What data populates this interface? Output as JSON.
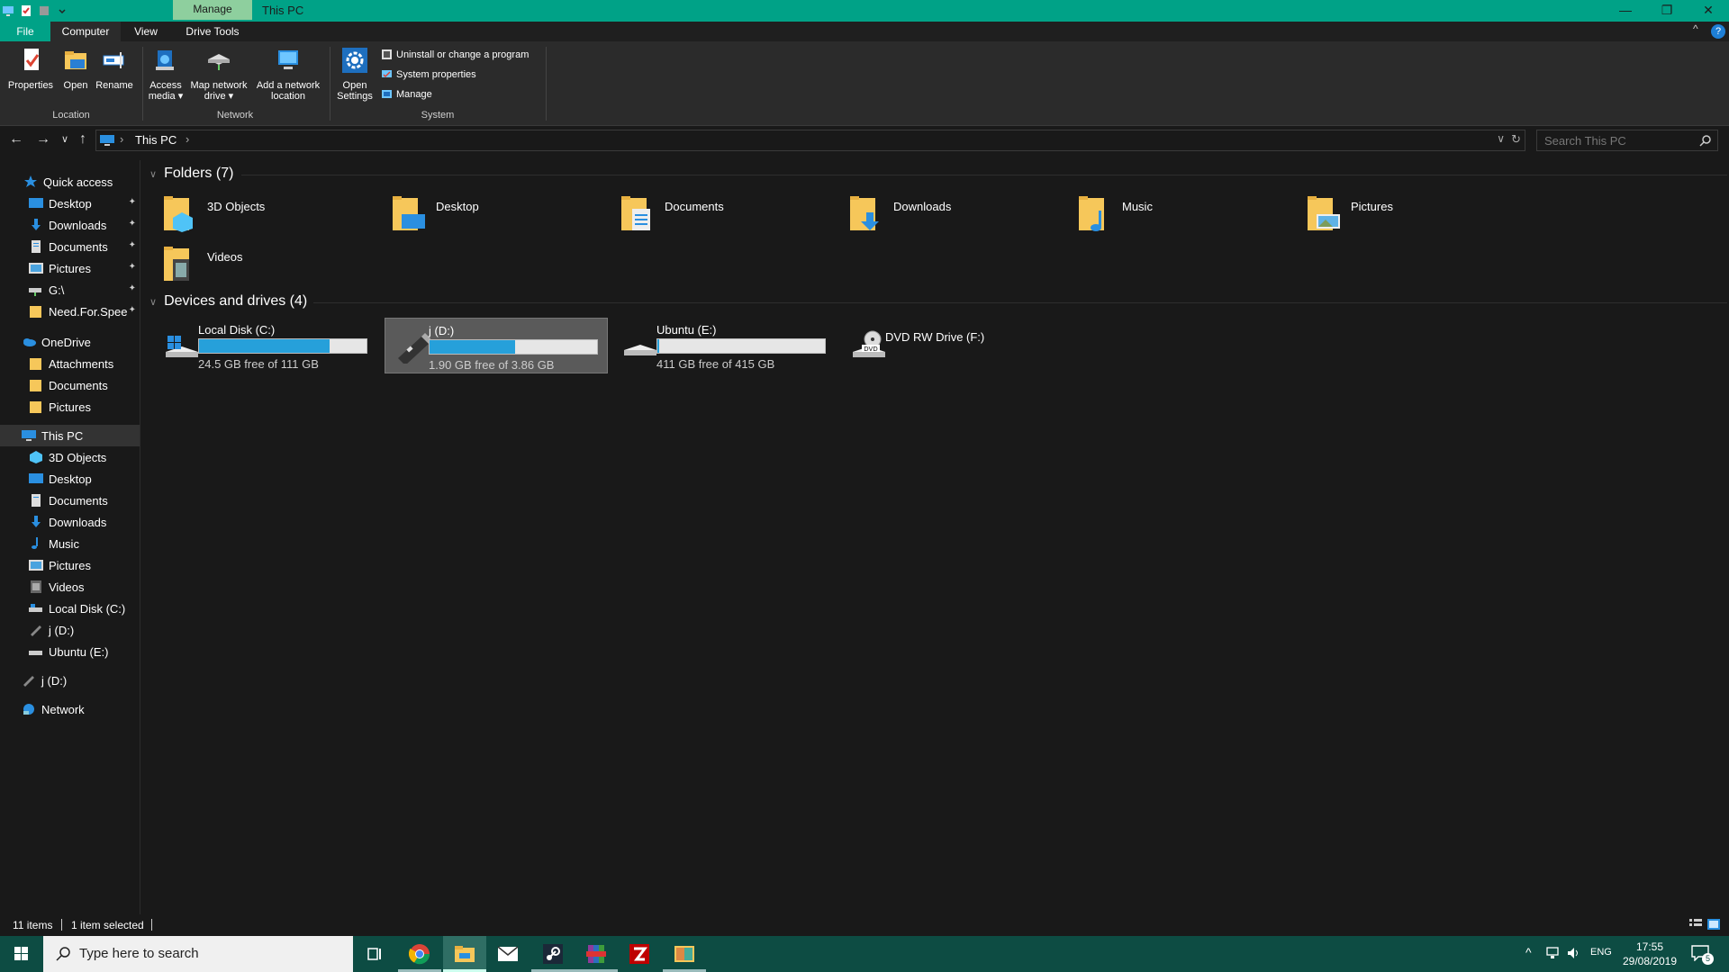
{
  "window": {
    "title": "This PC",
    "context_tab": "Manage",
    "minimize": "—",
    "restore": "❐",
    "close": "✕"
  },
  "ribbon": {
    "tabs": {
      "file": "File",
      "computer": "Computer",
      "view": "View",
      "drive_tools": "Drive Tools"
    },
    "location": {
      "label": "Location",
      "properties": "Properties",
      "open": "Open",
      "rename": "Rename"
    },
    "network": {
      "label": "Network",
      "access_media_1": "Access",
      "access_media_2": "media ▾",
      "map_drive_1": "Map network",
      "map_drive_2": "drive ▾",
      "add_location_1": "Add a network",
      "add_location_2": "location"
    },
    "system": {
      "label": "System",
      "open_settings_1": "Open",
      "open_settings_2": "Settings",
      "uninstall": "Uninstall or change a program",
      "system_properties": "System properties",
      "manage": "Manage"
    },
    "collapse": "^",
    "help": "?"
  },
  "address": {
    "crumb": "This PC",
    "sep": "›",
    "dropdown": "∨",
    "refresh": "↻",
    "search_placeholder": "Search This PC"
  },
  "nav": {
    "back": "←",
    "forward": "→",
    "recent": "∨",
    "up": "↑"
  },
  "sidebar": {
    "quick_access": "Quick access",
    "qa_items": [
      "Desktop",
      "Downloads",
      "Documents",
      "Pictures",
      "G:\\",
      "Need.For.Spee"
    ],
    "onedrive": "OneDrive",
    "od_items": [
      "Attachments",
      "Documents",
      "Pictures"
    ],
    "this_pc": "This PC",
    "pc_items": [
      "3D Objects",
      "Desktop",
      "Documents",
      "Downloads",
      "Music",
      "Pictures",
      "Videos",
      "Local Disk (C:)",
      "j (D:)",
      "Ubuntu (E:)"
    ],
    "removable": "j (D:)",
    "network": "Network",
    "pin": "📌"
  },
  "content": {
    "folders_header": "Folders (7)",
    "folders": [
      "3D Objects",
      "Desktop",
      "Documents",
      "Downloads",
      "Music",
      "Pictures",
      "Videos"
    ],
    "devices_header": "Devices and drives (4)",
    "drives": [
      {
        "name": "Local Disk (C:)",
        "free": "24.5 GB free of 111 GB",
        "used_fraction": 0.78
      },
      {
        "name": "j (D:)",
        "free": "1.90 GB free of 3.86 GB",
        "used_fraction": 0.51
      },
      {
        "name": "Ubuntu (E:)",
        "free": "411 GB free of 415 GB",
        "used_fraction": 0.01
      },
      {
        "name": "DVD RW Drive (F:)"
      }
    ]
  },
  "status": {
    "items": "11 items",
    "selected": "1 item selected"
  },
  "taskbar": {
    "search_placeholder": "Type here to search",
    "tray_lang": "ENG",
    "tray_up": "^",
    "time": "17:55",
    "date": "29/08/2019",
    "notifications": "5"
  },
  "colors": {
    "accent": "#00a287",
    "taskbar": "#0d4c43",
    "bar_fill": "#26a0da",
    "folder": "#f6c75a"
  }
}
